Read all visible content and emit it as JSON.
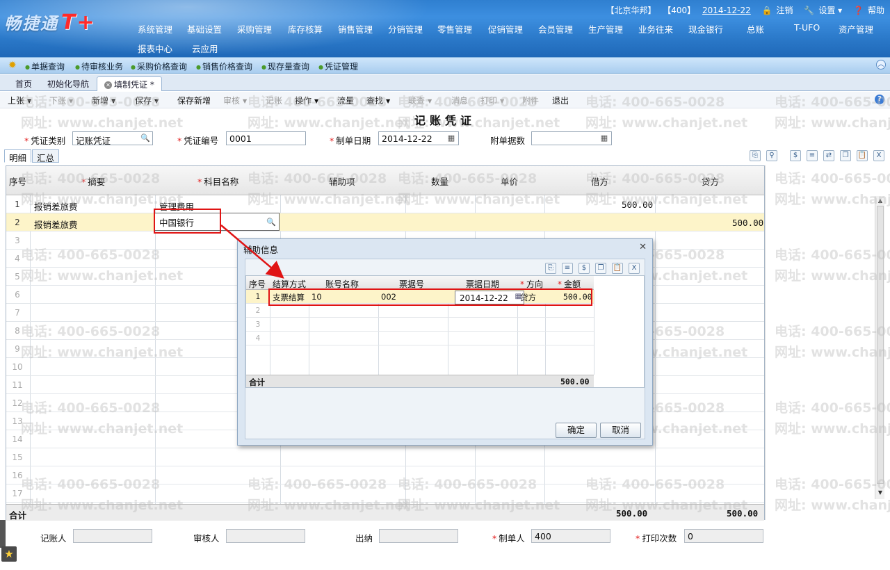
{
  "app": {
    "logo_text": "畅捷通",
    "logo_suffix": "T+"
  },
  "topinfo": {
    "account": "【北京华邦】",
    "user": "【400】",
    "date": "2014-12-22",
    "logout": "注销",
    "settings": "设置",
    "help": "帮助"
  },
  "mainmenu": {
    "row1": [
      "系统管理",
      "基础设置",
      "采购管理",
      "库存核算",
      "销售管理",
      "分销管理",
      "零售管理",
      "促销管理",
      "会员管理",
      "生产管理",
      "业务往来",
      "现金银行",
      "总账",
      "T-UFO",
      "资产管理"
    ],
    "row2": [
      "报表中心",
      "云应用"
    ]
  },
  "quickbar": [
    "单据查询",
    "待审核业务",
    "采购价格查询",
    "销售价格查询",
    "现存量查询",
    "凭证管理"
  ],
  "tabs": {
    "home": "首页",
    "init": "初始化导航",
    "active": "填制凭证 *"
  },
  "toolbar": {
    "prev": "上张",
    "next": "下张",
    "new": "新增",
    "save": "保存",
    "save_new": "保存新增",
    "audit": "审核",
    "post": "记账",
    "operate": "操作",
    "flow": "流量",
    "find": "查找",
    "link": "联查",
    "message": "消息",
    "print": "打印",
    "attach": "附件",
    "exit": "退出"
  },
  "watermark": {
    "phone": "电话: 400-665-0028",
    "site": "网址: www.chanjet.net"
  },
  "voucher": {
    "title": "记账凭证",
    "type_label": "凭证类别",
    "type_value": "记账凭证",
    "no_label": "凭证编号",
    "no_value": "0001",
    "date_label": "制单日期",
    "date_value": "2014-12-22",
    "attach_label": "附单据数",
    "attach_value": ""
  },
  "subtabs": {
    "detail": "明细",
    "summary": "汇总"
  },
  "grid": {
    "headers": {
      "seq": "序号",
      "summary": "摘要",
      "account": "科目名称",
      "aux": "辅助项",
      "qty": "数量",
      "price": "单价",
      "debit": "借方",
      "credit": "贷方"
    },
    "rows": [
      {
        "seq": "1",
        "summary": "报销差旅费",
        "account": "管理费用",
        "debit": "500.00",
        "credit": ""
      },
      {
        "seq": "2",
        "summary": "报销差旅费",
        "account": "中国银行",
        "debit": "",
        "credit": "500.00"
      }
    ],
    "empty_rows": [
      "3",
      "4",
      "5",
      "6",
      "7",
      "8",
      "9",
      "10",
      "11",
      "12",
      "13",
      "14",
      "15",
      "16",
      "17"
    ],
    "total_label": "合计",
    "total_debit": "500.00",
    "total_credit": "500.00"
  },
  "footer": {
    "bookkeeper": "记账人",
    "auditor": "审核人",
    "cashier": "出纳",
    "maker": "制单人",
    "maker_value": "400",
    "print_count": "打印次数",
    "print_count_value": "0"
  },
  "dialog": {
    "title": "辅助信息",
    "headers": {
      "seq": "序号",
      "method": "结算方式",
      "account": "账号名称",
      "bill_no": "票据号",
      "bill_date": "票据日期",
      "direction": "方向",
      "amount": "金额"
    },
    "rows": [
      {
        "seq": "1",
        "method": "支票结算",
        "account": "10",
        "bill_no": "002",
        "bill_date": "2014-12-22",
        "direction": "贷方",
        "amount": "500.00"
      }
    ],
    "empty_rows": [
      "2",
      "3",
      "4"
    ],
    "total_label": "合计",
    "total_amount": "500.00",
    "ok": "确定",
    "cancel": "取消"
  },
  "colors": {
    "banner": "#2f7fd0",
    "selected_row": "#fdf4c9",
    "highlight": "#e01414",
    "required": "#e21b1b"
  }
}
